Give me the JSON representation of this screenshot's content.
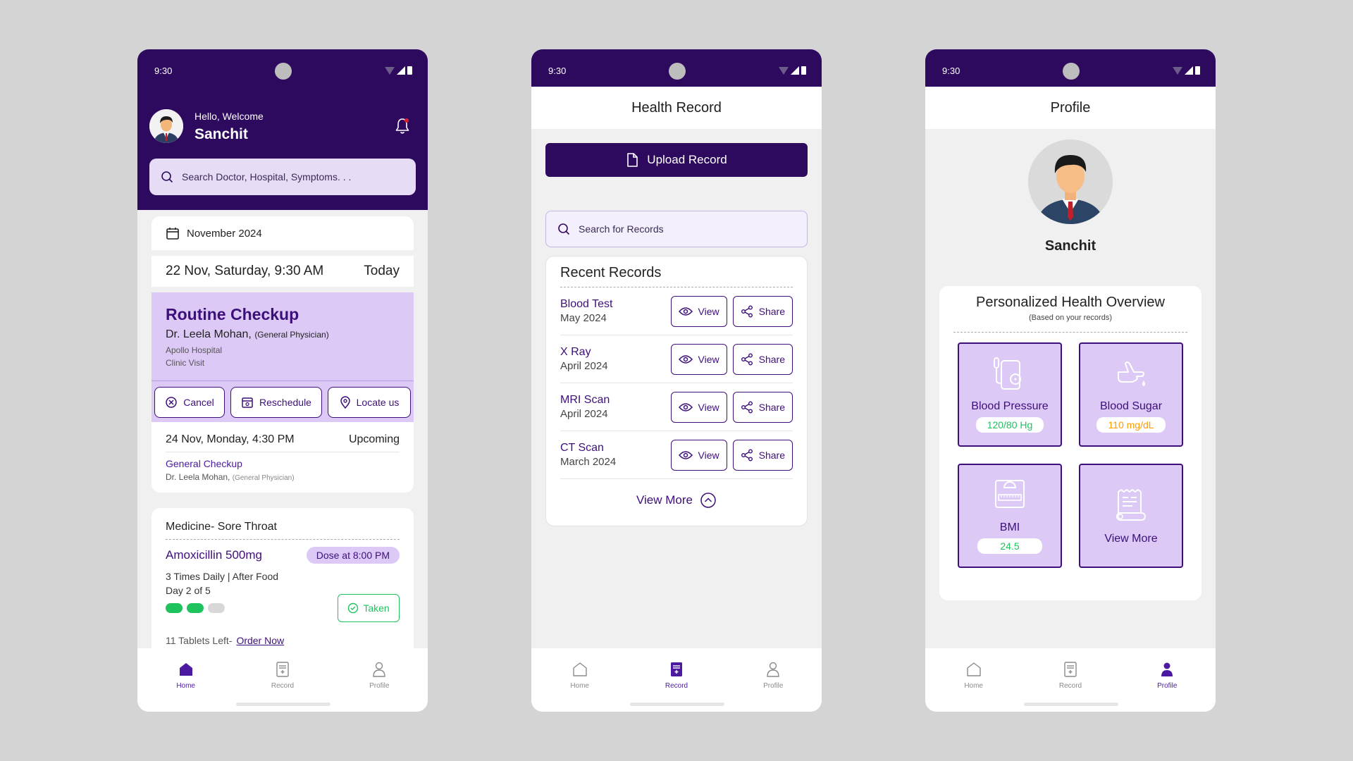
{
  "status_time": "9:30",
  "nav": {
    "home": "Home",
    "record": "Record",
    "profile": "Profile"
  },
  "home": {
    "greeting": "Hello, Welcome",
    "user_name": "Sanchit",
    "search_placeholder": "Search Doctor, Hospital, Symptoms. . .",
    "month": "November 2024",
    "appointment_date": "22 Nov, Saturday, 9:30 AM",
    "appointment_tag": "Today",
    "appointment_title": "Routine Checkup",
    "doctor": "Dr. Leela Mohan,",
    "doctor_role": "(General Physician)",
    "hospital": "Apollo Hospital",
    "visit_type": "Clinic Visit",
    "btn_cancel": "Cancel",
    "btn_reschedule": "Reschedule",
    "btn_locate": "Locate us",
    "upcoming_date": "24 Nov, Monday, 4:30 PM",
    "upcoming_tag": "Upcoming",
    "upcoming_title": "General Checkup",
    "upcoming_doctor": "Dr. Leela Mohan,",
    "upcoming_role": "(General Physician)",
    "medicine_header": "Medicine- Sore Throat",
    "medicine_name": "Amoxicillin 500mg",
    "dose_time": "Dose at 8:00 PM",
    "frequency": "3 Times Daily | After Food",
    "day": "Day 2 of 5",
    "taken_label": "Taken",
    "tablets_left": "11 Tablets Left-",
    "order_now": "Order Now",
    "doses_taken": 2,
    "doses_total": 3
  },
  "record": {
    "title": "Health Record",
    "upload": "Upload Record",
    "search_placeholder": "Search for Records",
    "recent_title": "Recent Records",
    "items": [
      {
        "name": "Blood Test",
        "date": "May 2024"
      },
      {
        "name": "X Ray",
        "date": "April 2024"
      },
      {
        "name": "MRI Scan",
        "date": "April 2024"
      },
      {
        "name": "CT Scan",
        "date": "March 2024"
      }
    ],
    "view_label": "View",
    "share_label": "Share",
    "view_more": "View More"
  },
  "profile": {
    "title": "Profile",
    "name": "Sanchit",
    "overview_title": "Personalized Health Overview",
    "overview_sub": "(Based on your records)",
    "bp_label": "Blood Pressure",
    "bp_value": "120/80 Hg",
    "sugar_label": "Blood Sugar",
    "sugar_value": "110 mg/dL",
    "bmi_label": "BMI",
    "bmi_value": "24.5",
    "view_more": "View More"
  },
  "colors": {
    "primary": "#2e0a5f",
    "accent": "#3d0f7a",
    "lavender": "#dcc9f6",
    "green": "#1ec35e",
    "orange": "#ff9a00"
  }
}
